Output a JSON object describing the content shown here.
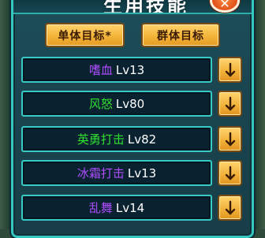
{
  "window": {
    "title": "生用技能",
    "close_icon": "close-icon"
  },
  "tabs": [
    {
      "label": "单体目标*",
      "selected": true
    },
    {
      "label": "群体目标",
      "selected": false
    }
  ],
  "skills": [
    {
      "name": "嗜血",
      "level": "Lv13",
      "color": "#b04dff"
    },
    {
      "name": "风怒",
      "level": "Lv80",
      "color": "#2fe02f"
    },
    {
      "name": "英勇打击",
      "level": "Lv82",
      "color": "#2fe02f"
    },
    {
      "name": "冰霜打击",
      "level": "Lv13",
      "color": "#b04dff"
    },
    {
      "name": "乱舞",
      "level": "Lv14",
      "color": "#b04dff"
    }
  ],
  "colors": {
    "panel_border": "#35c6c0",
    "button_gold": "#f3b43a",
    "rare_purple": "#b04dff",
    "uncommon_green": "#2fe02f"
  }
}
